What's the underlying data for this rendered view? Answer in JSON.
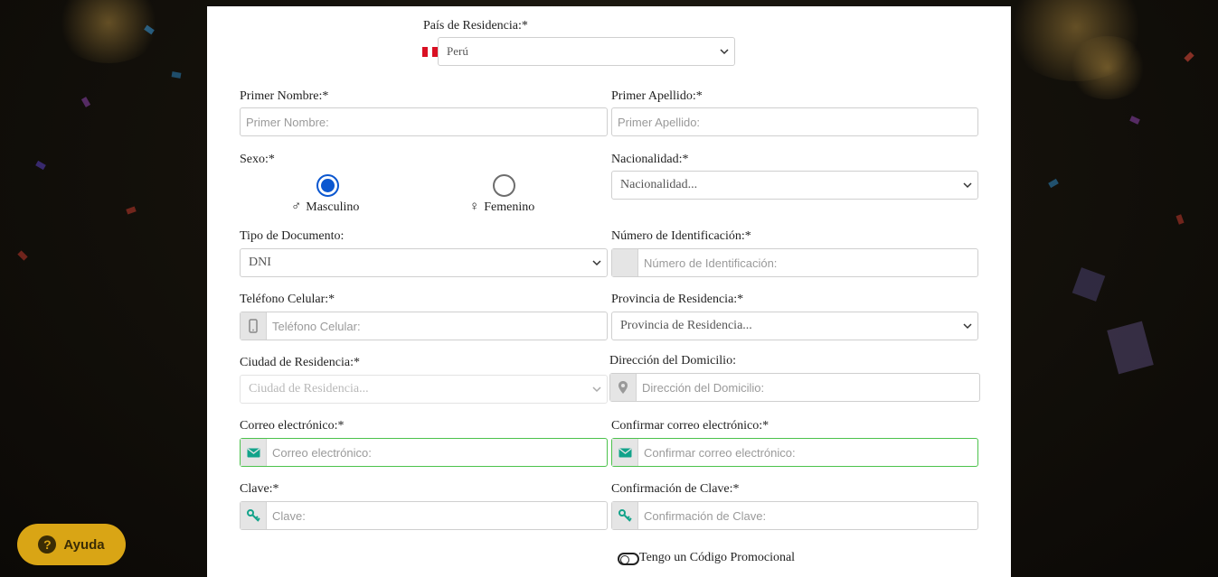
{
  "form": {
    "country": {
      "label": "País de Residencia:*",
      "value": "Perú"
    },
    "first_name": {
      "label": "Primer Nombre:*",
      "placeholder": "Primer Nombre:"
    },
    "last_name": {
      "label": "Primer Apellido:*",
      "placeholder": "Primer Apellido:"
    },
    "sex": {
      "label": "Sexo:*",
      "male": "Masculino",
      "female": "Femenino",
      "male_symbol": "♂",
      "female_symbol": "♀",
      "selected": "Masculino"
    },
    "nationality": {
      "label": "Nacionalidad:*",
      "value": "Nacionalidad..."
    },
    "doc_type": {
      "label": "Tipo de Documento:",
      "value": "DNI"
    },
    "id_number": {
      "label": "Número de Identificación:*",
      "placeholder": "Número de Identificación:"
    },
    "phone": {
      "label": "Teléfono Celular:*",
      "placeholder": "Teléfono Celular:"
    },
    "province": {
      "label": "Provincia de Residencia:*",
      "value": "Provincia de Residencia..."
    },
    "city": {
      "label": "Ciudad de Residencia:*",
      "value": "Ciudad de Residencia..."
    },
    "address": {
      "label": "Dirección del Domicilio:",
      "placeholder": "Dirección del Domicilio:"
    },
    "email": {
      "label": "Correo electrónico:*",
      "placeholder": "Correo electrónico:"
    },
    "email_confirm": {
      "label": "Confirmar correo electrónico:*",
      "placeholder": "Confirmar correo electrónico:"
    },
    "password": {
      "label": "Clave:*",
      "placeholder": "Clave:"
    },
    "password_confirm": {
      "label": "Confirmación de Clave:*",
      "placeholder": "Confirmación de Clave:"
    },
    "promo": {
      "label": "Tengo un Código Promocional"
    }
  },
  "help": {
    "label": "Ayuda",
    "icon": "?"
  },
  "colors": {
    "accent_blue": "#0b57d0",
    "valid_green": "#4cc24c",
    "icon_teal": "#12a38a",
    "help_gold": "#d9a515"
  }
}
